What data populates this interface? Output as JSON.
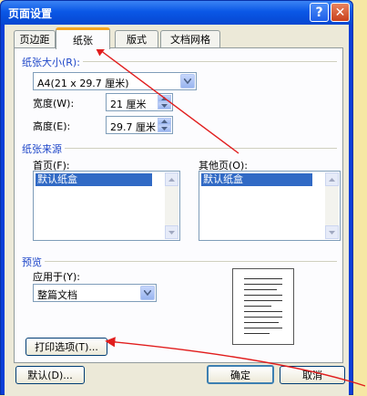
{
  "window": {
    "title": "页面设置",
    "help_symbol": "?",
    "close_symbol": "✕"
  },
  "tabs": [
    {
      "label": "页边距",
      "active": false
    },
    {
      "label": "纸张",
      "active": true
    },
    {
      "label": "版式",
      "active": false
    },
    {
      "label": "文档网格",
      "active": false
    }
  ],
  "paper_size": {
    "group_label": "纸张大小(R):",
    "size_value": "A4(21 x 29.7 厘米)",
    "width_label": "宽度(W):",
    "width_value": "21 厘米",
    "height_label": "高度(E):",
    "height_value": "29.7 厘米"
  },
  "paper_source": {
    "group_label": "纸张来源",
    "first_page_label": "首页(F):",
    "first_page_item": "默认纸盒",
    "other_pages_label": "其他页(O):",
    "other_pages_item": "默认纸盒"
  },
  "preview": {
    "group_label": "预览",
    "apply_to_label": "应用于(Y):",
    "apply_to_value": "整篇文档"
  },
  "buttons": {
    "print_options": "打印选项(T)...",
    "default": "默认(D)...",
    "ok": "确定",
    "cancel": "取消"
  },
  "colors": {
    "title_bar": "#0a57e6",
    "dialog_face": "#ece9d8",
    "group_title": "#1e46c8",
    "annotation": "#e11d1d",
    "selection": "#316ac5"
  }
}
